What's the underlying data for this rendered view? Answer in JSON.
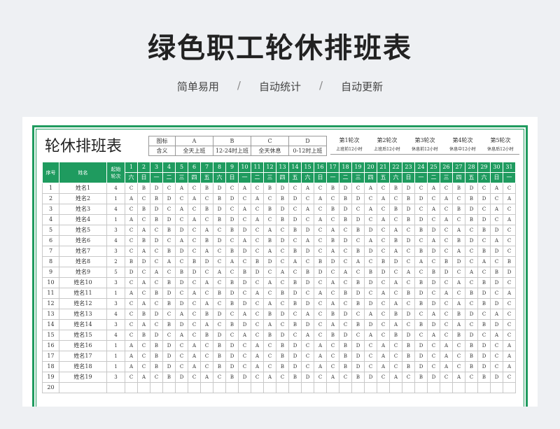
{
  "page": {
    "title": "绿色职工轮休排班表",
    "subtitle": [
      "简单易用",
      "自动统计",
      "自动更新"
    ],
    "separator": "/"
  },
  "sheet": {
    "title": "轮休排班表",
    "legend": {
      "row1": [
        "图标",
        "A",
        "B",
        "C",
        "D"
      ],
      "row2": [
        "含义",
        "全天上班",
        "12-24时上班",
        "全天休息",
        "0-12时上班"
      ]
    },
    "rounds": [
      {
        "label": "第1轮次",
        "desc": "上班前12小时"
      },
      {
        "label": "第2轮次",
        "desc": "上班后12小时"
      },
      {
        "label": "第3轮次",
        "desc": "休息前12小时"
      },
      {
        "label": "第4轮次",
        "desc": "休息中12小时"
      },
      {
        "label": "第5轮次",
        "desc": "休息后12小时"
      }
    ],
    "headers": {
      "seq": "序号",
      "name": "姓名",
      "start": "起始轮次"
    },
    "days": [
      "1",
      "2",
      "3",
      "4",
      "5",
      "6",
      "7",
      "8",
      "9",
      "10",
      "11",
      "12",
      "13",
      "14",
      "15",
      "16",
      "17",
      "18",
      "19",
      "20",
      "21",
      "22",
      "23",
      "24",
      "25",
      "26",
      "27",
      "28",
      "29",
      "30",
      "31"
    ],
    "weekdays": [
      "六",
      "日",
      "一",
      "二",
      "三",
      "四",
      "五",
      "六",
      "日",
      "一",
      "二",
      "三",
      "四",
      "五",
      "六",
      "日",
      "一",
      "二",
      "三",
      "四",
      "五",
      "六",
      "日",
      "一",
      "二",
      "三",
      "四",
      "五",
      "六",
      "日",
      "一"
    ],
    "rows": [
      {
        "seq": "1",
        "name": "姓名1",
        "start": "4",
        "cells": "CBDCACBDCACBDCACBDCACBDCACBDCAC"
      },
      {
        "seq": "2",
        "name": "姓名2",
        "start": "1",
        "cells": "ACBDCACBDCACBDCACBDCACBDCACBDCA"
      },
      {
        "seq": "3",
        "name": "姓名3",
        "start": "4",
        "cells": "CBDCACBDCACBDCACBDCACBDCACBDCAC"
      },
      {
        "seq": "4",
        "name": "姓名4",
        "start": "1",
        "cells": "ACBDCACBDCACBDCACBDCACBDCACBDCA"
      },
      {
        "seq": "5",
        "name": "姓名5",
        "start": "3",
        "cells": "CACBDCACBDCACBDCACBDCACBDCACBDC"
      },
      {
        "seq": "6",
        "name": "姓名6",
        "start": "4",
        "cells": "CBDCACBDCACBDCACBDCACBDCACBDCAC"
      },
      {
        "seq": "7",
        "name": "姓名7",
        "start": "3",
        "cells": "CACBDCACBDCACBDCACBDCACBDCACBDC"
      },
      {
        "seq": "8",
        "name": "姓名8",
        "start": "2",
        "cells": "BDCACBDCACBDCACBDCACBDCACBDCACB"
      },
      {
        "seq": "9",
        "name": "姓名9",
        "start": "5",
        "cells": "DCACBDCACBDCACBDCACBDCACBDCACBD"
      },
      {
        "seq": "10",
        "name": "姓名10",
        "start": "3",
        "cells": "CACBDCACBDCACBDCACBDCACBDCACBDC"
      },
      {
        "seq": "11",
        "name": "姓名11",
        "start": "1",
        "cells": "ACBDCACBDCACBDCACBDCACBDCACBDCA"
      },
      {
        "seq": "12",
        "name": "姓名12",
        "start": "3",
        "cells": "CACBDCACBDCACBDCACBDCACBDCACBDC"
      },
      {
        "seq": "13",
        "name": "姓名13",
        "start": "4",
        "cells": "CBDCACBDCACBDCACBDCACBDCACBDCAC"
      },
      {
        "seq": "14",
        "name": "姓名14",
        "start": "3",
        "cells": "CACBDCACBDCACBDCACBDCACBDCACBDC"
      },
      {
        "seq": "15",
        "name": "姓名15",
        "start": "4",
        "cells": "CBDCACBDCACBDCACBDCACBDCACBDCAC"
      },
      {
        "seq": "16",
        "name": "姓名16",
        "start": "1",
        "cells": "ACBDCACBDCACBDCACBDCACBDCACBDCA"
      },
      {
        "seq": "17",
        "name": "姓名17",
        "start": "1",
        "cells": "ACBDCACBDCACBDCACBDCACBDCACBDCA"
      },
      {
        "seq": "18",
        "name": "姓名18",
        "start": "1",
        "cells": "ACBDCACBDCACBDCACBDCACBDCACBDCA"
      },
      {
        "seq": "19",
        "name": "姓名19",
        "start": "3",
        "cells": "CACBDCACBDCACBDCACBDCACBDCACBDC"
      },
      {
        "seq": "20",
        "name": "",
        "start": "",
        "cells": ""
      }
    ]
  }
}
